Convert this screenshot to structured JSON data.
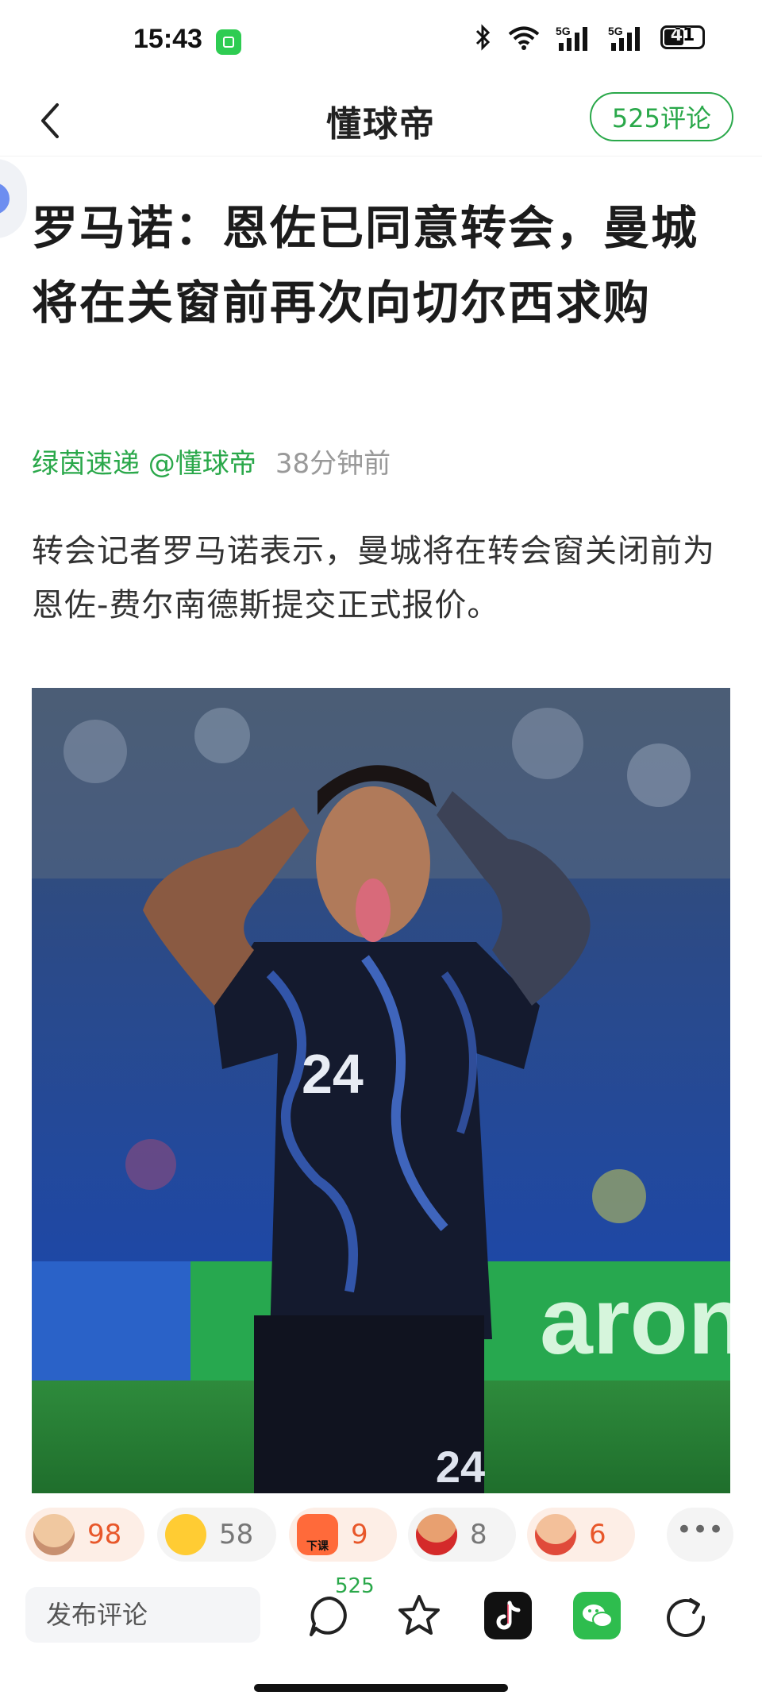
{
  "status_bar": {
    "time": "15:43",
    "battery": "41",
    "network_a": "5G",
    "network_b": "5G"
  },
  "nav": {
    "title": "懂球帝",
    "comments_pill": "525评论"
  },
  "article": {
    "headline": "罗马诺：恩佐已同意转会，曼城将在关窗前再次向切尔西求购",
    "source": "绿茵速递 @懂球帝",
    "time_ago": "38分钟前",
    "body": "转会记者罗马诺表示，曼城将在转会窗关闭前为恩佐-费尔南德斯提交正式报价。",
    "image": {
      "jersey_number": "24",
      "board_text": "aron"
    }
  },
  "reactions": [
    {
      "icon": "bald-man-face-icon",
      "count": "98",
      "bg": "#fdeee6",
      "color": "#e8572a"
    },
    {
      "icon": "laughing-tears-emoji-icon",
      "count": "58",
      "bg": "#f4f4f4",
      "color": "#777777"
    },
    {
      "icon": "angry-class-dismissed-icon",
      "count": "9",
      "bg": "#fdeee6",
      "color": "#e8572a",
      "tag": "下课"
    },
    {
      "icon": "red-jersey-man-icon",
      "count": "8",
      "bg": "#f4f4f4",
      "color": "#777777"
    },
    {
      "icon": "facepalm-man-icon",
      "count": "6",
      "bg": "#fdeee6",
      "color": "#e8572a"
    }
  ],
  "bottom_bar": {
    "comment_placeholder": "发布评论",
    "comment_count": "525"
  }
}
